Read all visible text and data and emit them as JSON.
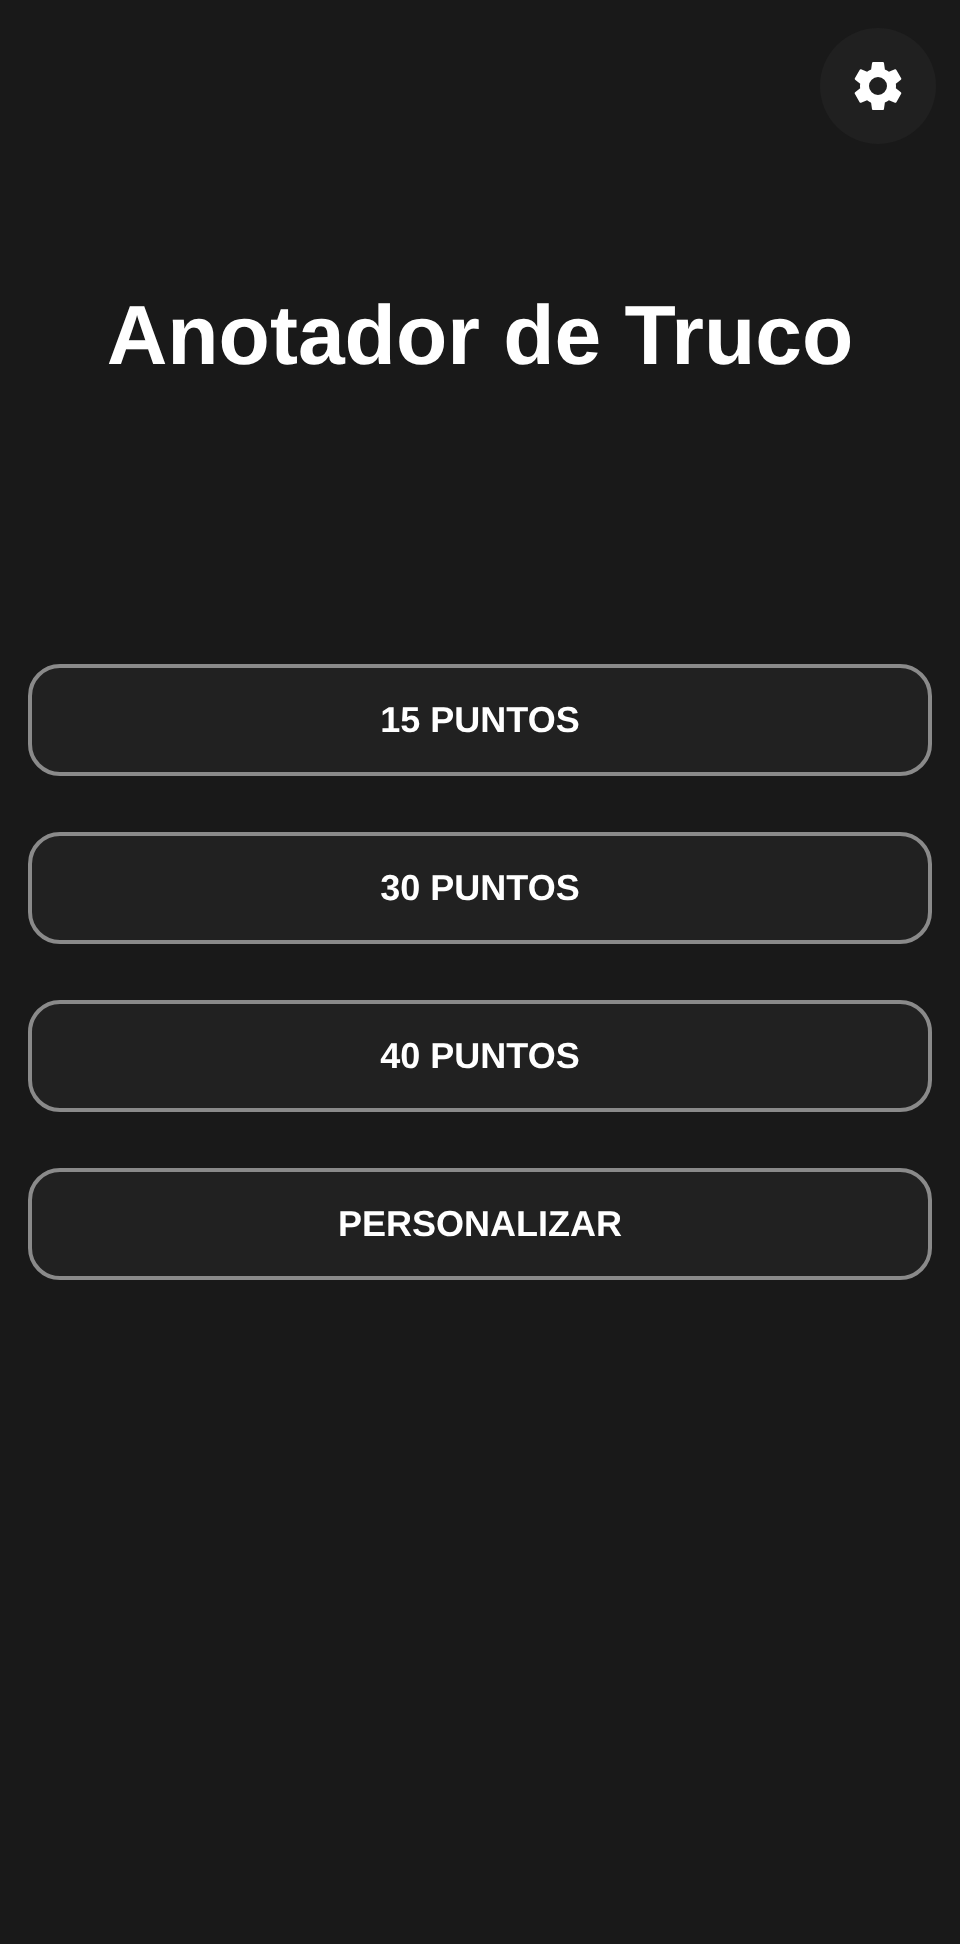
{
  "title": "Anotador de Truco",
  "buttons": [
    "15 PUNTOS",
    "30 PUNTOS",
    "40 PUNTOS",
    "PERSONALIZAR"
  ]
}
